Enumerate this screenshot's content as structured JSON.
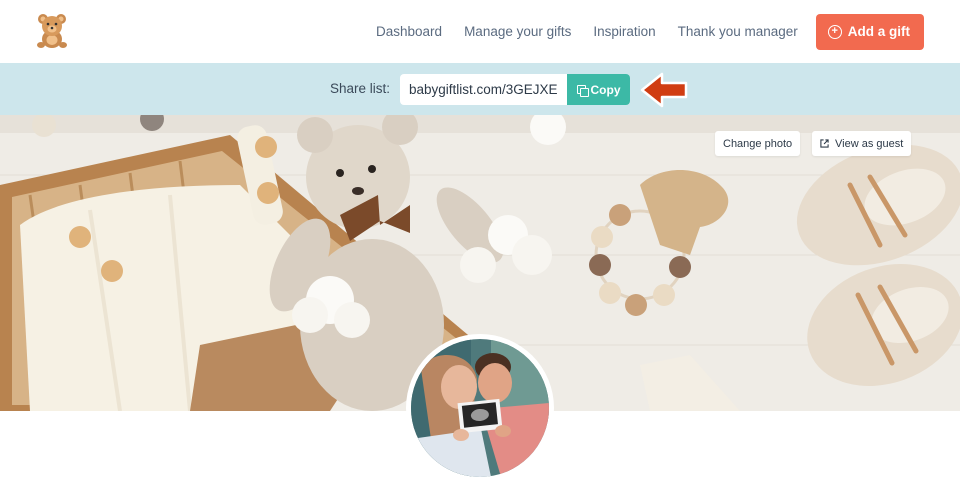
{
  "nav": {
    "logo_icon": "teddy-bear-icon",
    "links": [
      {
        "label": "Dashboard"
      },
      {
        "label": "Manage your gifts"
      },
      {
        "label": "Inspiration"
      },
      {
        "label": "Thank you manager"
      }
    ],
    "add_button": {
      "label": "Add a gift",
      "icon": "plus-circle-icon",
      "color": "#f26a4f"
    }
  },
  "share": {
    "label": "Share list:",
    "url": "babygiftlist.com/3GEJXE",
    "copy_label": "Copy",
    "copy_color": "#3cb9a6",
    "bar_color": "#cde6ec",
    "arrow_color": "#d03d12"
  },
  "cover": {
    "change_photo_label": "Change photo",
    "view_as_guest_label": "View as guest"
  }
}
